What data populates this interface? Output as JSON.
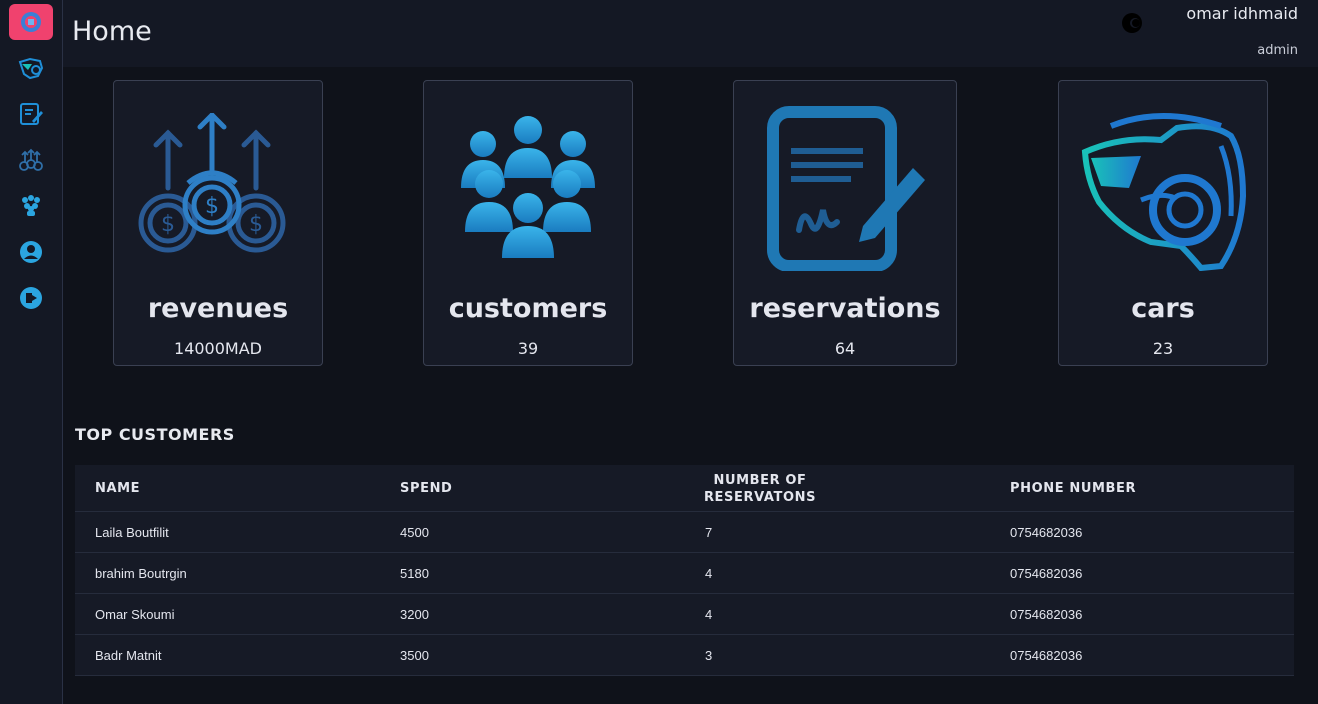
{
  "header": {
    "title": "Home",
    "user_name": "omar idhmaid",
    "user_role": "admin"
  },
  "sidebar": {
    "items": [
      {
        "icon": "dashboard-icon",
        "active": true
      },
      {
        "icon": "car-icon"
      },
      {
        "icon": "reservation-list-icon"
      },
      {
        "icon": "revenue-icon"
      },
      {
        "icon": "customers-icon"
      },
      {
        "icon": "profile-icon"
      },
      {
        "icon": "logout-icon"
      }
    ]
  },
  "stats": [
    {
      "title": "revenues",
      "value": "14000MAD",
      "icon": "revenue-arrows-coins-icon"
    },
    {
      "title": "customers",
      "value": "39",
      "icon": "customers-group-icon"
    },
    {
      "title": "reservations",
      "value": "64",
      "icon": "reservation-document-icon"
    },
    {
      "title": "cars",
      "value": "23",
      "icon": "sports-car-icon"
    }
  ],
  "top_customers": {
    "title": "TOP CUSTOMERS",
    "columns": [
      "NAME",
      "SPEND",
      "NUMBER OF RESERVATONS",
      "PHONE NUMBER"
    ],
    "column_lines": {
      "reservations_line1": "NUMBER OF",
      "reservations_line2": "RESERVATONS"
    },
    "rows": [
      {
        "name": "Laila Boutfilit",
        "spend": "4500",
        "reservations": "7",
        "phone": "0754682036"
      },
      {
        "name": "brahim Boutrgin",
        "spend": "5180",
        "reservations": "4",
        "phone": "0754682036"
      },
      {
        "name": "Omar Skoumi",
        "spend": "3200",
        "reservations": "4",
        "phone": "0754682036"
      },
      {
        "name": "Badr Matnit",
        "spend": "3500",
        "reservations": "3",
        "phone": "0754682036"
      }
    ]
  },
  "colors": {
    "background": "#0f121a",
    "panel": "#141824",
    "card": "#161a26",
    "accent_active": "#f0426e",
    "icon_blue": "#1f8fd8"
  }
}
